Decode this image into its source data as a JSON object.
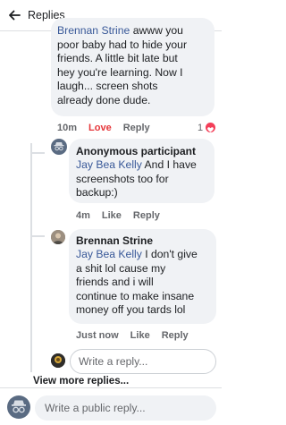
{
  "header": {
    "title": "Replies"
  },
  "comments": [
    {
      "author": "Brennan Strine",
      "lines": [
        "poor baby had to hide your",
        "friends. A little bit late but",
        "hey you're learning. Now I",
        "laugh... screen shots",
        "already done dude."
      ],
      "first_line_mention": "Brennan Strine",
      "first_line_rest": " awww you",
      "time": "10m",
      "love_label": "Love",
      "reply_label": "Reply",
      "reaction_count": "1"
    },
    {
      "author": "Anonymous participant",
      "mention": "Jay Bea Kelly",
      "first_line_rest": " And I have",
      "lines": [
        "screenshots too for",
        "backup:)"
      ],
      "time": "4m",
      "like_label": "Like",
      "reply_label": "Reply"
    },
    {
      "author": "Brennan Strine",
      "mention": "Jay Bea Kelly",
      "first_line_rest": " I don't give",
      "lines": [
        "a shit lol cause my",
        "friends and i will",
        "continue to make insane",
        "money off you tards lol"
      ],
      "time": "Just now",
      "like_label": "Like",
      "reply_label": "Reply"
    }
  ],
  "reply_input": {
    "placeholder": "Write a reply..."
  },
  "view_more": "View more replies...",
  "footer_input": {
    "placeholder": "Write a public reply..."
  },
  "colors": {
    "link": "#385898",
    "love": "#e5363a",
    "bubble": "#f0f2f5",
    "anon_avatar": "#5a6b82"
  }
}
